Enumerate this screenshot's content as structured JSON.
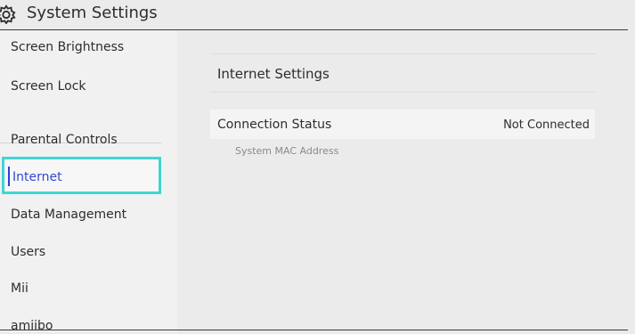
{
  "header": {
    "title": "System Settings",
    "icon": "gear-icon"
  },
  "sidebar": {
    "items": [
      {
        "label": "Screen Brightness"
      },
      {
        "label": "Screen Lock"
      },
      {
        "label": "Parental Controls"
      },
      {
        "label": "Internet"
      },
      {
        "label": "Data Management"
      },
      {
        "label": "Users"
      },
      {
        "label": "Mii"
      },
      {
        "label": "amiibo"
      }
    ],
    "selected_index": 3,
    "selection_color": "#3fd6d2",
    "selected_text_color": "#3447d6"
  },
  "main": {
    "section_title": "Internet Settings",
    "status_row": {
      "label": "Connection Status",
      "value": "Not Connected"
    },
    "mac_label": "System MAC Address"
  }
}
